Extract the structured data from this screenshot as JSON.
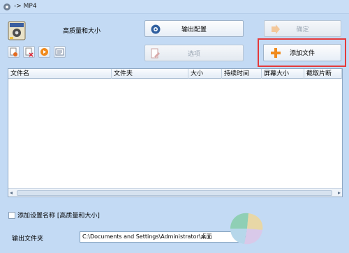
{
  "window": {
    "title": "-> MP4"
  },
  "preset": {
    "label": "高质量和大小"
  },
  "buttons": {
    "output_config": "输出配置",
    "ok": "确定",
    "options": "选项",
    "add_file": "添加文件"
  },
  "table": {
    "columns": [
      "文件名",
      "文件夹",
      "大小",
      "持续时间",
      "屏幕大小",
      "截取片断"
    ]
  },
  "options": {
    "append_preset_name": "添加设置名称 [高质量和大小]"
  },
  "output": {
    "label": "输出文件夹",
    "path": "C:\\Documents and Settings\\Administrator\\桌面"
  },
  "colors": {
    "accent_orange": "#f08a1c",
    "highlight_red": "#e53a3a",
    "window_bg": "#c3daf4"
  }
}
